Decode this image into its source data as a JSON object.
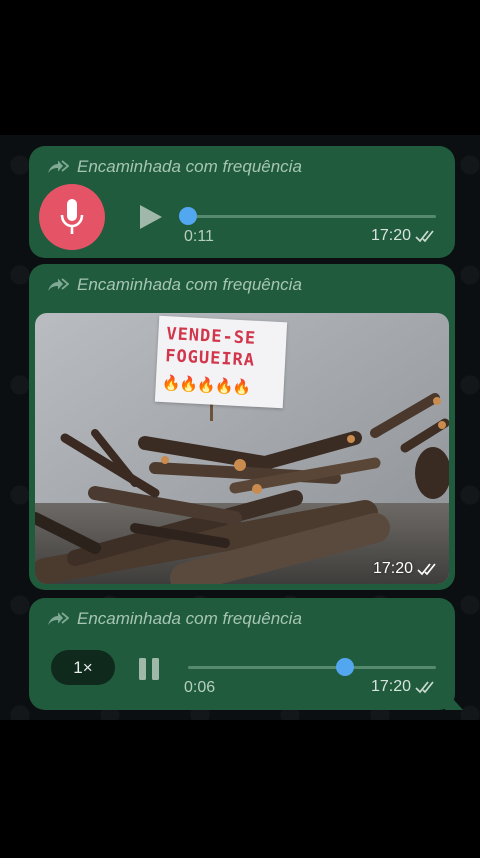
{
  "forwarded_label": "Encaminhada com frequência",
  "messages": [
    {
      "type": "voice",
      "duration": "0:11",
      "time": "17:20",
      "progress": 0.0,
      "state": "paused"
    },
    {
      "type": "image",
      "time": "17:20",
      "sign": {
        "line1": "VENDE-SE",
        "line2": "FOGUEIRA",
        "emojis": "🔥🔥🔥🔥🔥"
      }
    },
    {
      "type": "voice",
      "duration": "0:06",
      "time": "17:20",
      "progress": 0.63,
      "state": "playing",
      "speed": "1×"
    }
  ],
  "colors": {
    "bubble": "#1f5b3c",
    "accent_blue": "#53a7f1",
    "mic_avatar": "#e55466"
  },
  "icons": [
    "forwarded-icon",
    "microphone-icon",
    "play-icon",
    "pause-icon",
    "double-check-icon"
  ]
}
